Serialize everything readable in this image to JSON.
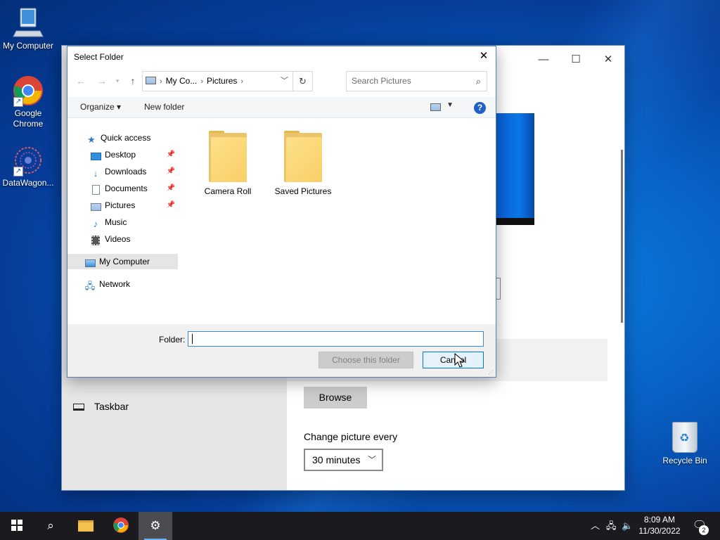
{
  "desktop": {
    "icons": [
      {
        "label": "My Computer"
      },
      {
        "label": "Google\nChrome"
      },
      {
        "label": "DataWagon..."
      }
    ],
    "recycle_bin": "Recycle Bin"
  },
  "settings_window": {
    "nav_item_taskbar": "Taskbar",
    "browse_label": "Browse",
    "change_picture_label": "Change picture every",
    "interval_value": "30 minutes",
    "minimize": "—",
    "maximize": "☐",
    "close": "✕"
  },
  "dialog": {
    "title": "Select Folder",
    "close": "✕",
    "breadcrumb": [
      "My Co...",
      "Pictures"
    ],
    "search_placeholder": "Search Pictures",
    "toolbar": {
      "organize": "Organize ▾",
      "new_folder": "New folder",
      "help": "?"
    },
    "tree": [
      {
        "label": "Quick access",
        "icon": "star-icon"
      },
      {
        "label": "Desktop",
        "icon": "desktop-icon",
        "pinned": true
      },
      {
        "label": "Downloads",
        "icon": "download-icon",
        "pinned": true
      },
      {
        "label": "Documents",
        "icon": "document-icon",
        "pinned": true
      },
      {
        "label": "Pictures",
        "icon": "pictures-icon",
        "pinned": true
      },
      {
        "label": "Music",
        "icon": "music-icon"
      },
      {
        "label": "Videos",
        "icon": "video-icon"
      },
      {
        "label": "My Computer",
        "icon": "computer-icon",
        "selected": true
      },
      {
        "label": "Network",
        "icon": "network-icon"
      }
    ],
    "folders": [
      {
        "name": "Camera Roll"
      },
      {
        "name": "Saved Pictures"
      }
    ],
    "folder_label": "Folder:",
    "folder_value": "",
    "choose_button": "Choose this folder",
    "cancel_button": "Cancel"
  },
  "taskbar": {
    "time": "8:09 AM",
    "date": "11/30/2022",
    "notification_count": "2"
  },
  "colors": {
    "accent": "#0078d7",
    "desktop": "#0861c4"
  }
}
